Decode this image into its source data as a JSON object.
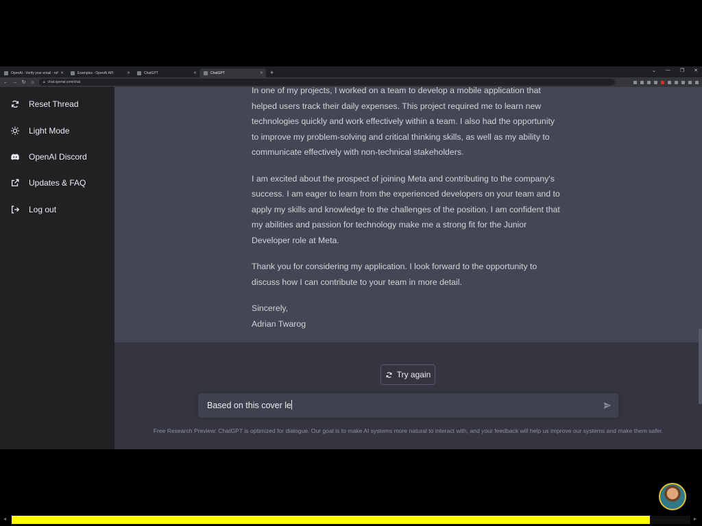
{
  "browser": {
    "tabs": [
      {
        "title": "OpenAI - Verify your email - ref"
      },
      {
        "title": "Examples - OpenAI API"
      },
      {
        "title": "ChatGPT"
      },
      {
        "title": "ChatGPT",
        "active": true
      }
    ],
    "new_tab": "+",
    "window_controls": [
      "⌄",
      "—",
      "❐",
      "✕"
    ],
    "url": "chat.openai.com/chat"
  },
  "sidebar": {
    "items": [
      {
        "label": "Reset Thread",
        "icon": "refresh-icon"
      },
      {
        "label": "Light Mode",
        "icon": "sun-icon"
      },
      {
        "label": "OpenAI Discord",
        "icon": "discord-icon"
      },
      {
        "label": "Updates & FAQ",
        "icon": "external-link-icon"
      },
      {
        "label": "Log out",
        "icon": "logout-icon"
      }
    ]
  },
  "conversation": {
    "paragraphs": [
      "In one of my projects, I worked on a team to develop a mobile application that helped users track their daily expenses. This project required me to learn new technologies quickly and work effectively within a team. I also had the opportunity to improve my problem-solving and critical thinking skills, as well as my ability to communicate effectively with non-technical stakeholders.",
      "I am excited about the prospect of joining Meta and contributing to the company's success. I am eager to learn from the experienced developers on your team and to apply my skills and knowledge to the challenges of the position. I am confident that my abilities and passion for technology make me a strong fit for the Junior Developer role at Meta.",
      "Thank you for considering my application. I look forward to the opportunity to discuss how I can contribute to your team in more detail."
    ],
    "closing": "Sincerely,",
    "signature": "Adrian Twarog"
  },
  "try_again_label": "Try again",
  "prompt": {
    "value": "Based on this cover le"
  },
  "footer": "Free Research Preview: ChatGPT is optimized for dialogue. Our goal is to make AI systems more natural to interact with, and your feedback will help us improve our systems and make them safer.",
  "video": {
    "progress_fraction": 0.94
  },
  "colors": {
    "sidebar_bg": "#202123",
    "chat_bg": "#343541",
    "answer_bg": "#444654",
    "progress": "#ffff00"
  }
}
